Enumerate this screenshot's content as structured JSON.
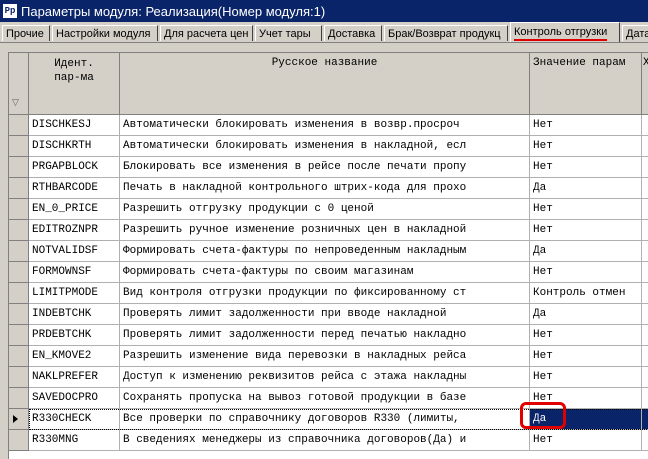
{
  "window": {
    "title": "Параметры модуля: Реализация(Номер модуля:1)",
    "icon_text": "Pp"
  },
  "tabs": [
    {
      "label": "Прочие",
      "active": false
    },
    {
      "label": "Настройки модуля",
      "active": false
    },
    {
      "label": "Для расчета цен",
      "active": false
    },
    {
      "label": "Учет тары",
      "active": false
    },
    {
      "label": "Доставка",
      "active": false
    },
    {
      "label": "Брак/Возврат продукц",
      "active": false
    },
    {
      "label": "Контроль отгрузки",
      "active": true
    },
    {
      "label": "Дата",
      "active": false
    }
  ],
  "columns": {
    "ident": "Идент.\nпар-ма",
    "name": "Русское название",
    "value": "Значение парам",
    "extra": "Х"
  },
  "rows": [
    {
      "ident": "DISCHKESJ",
      "name": "Автоматически блокировать изменения в возвр.просроч",
      "value": "Нет",
      "selected": false
    },
    {
      "ident": "DISCHKRTH",
      "name": "Автоматически блокировать изменения в накладной, есл",
      "value": "Нет",
      "selected": false
    },
    {
      "ident": "PRGAPBLOCK",
      "name": "Блокировать все изменения в рейсе после печати пропу",
      "value": "Нет",
      "selected": false
    },
    {
      "ident": "RTHBARCODE",
      "name": "Печать в накладной контрольного штрих-кода для прохо",
      "value": "Да",
      "selected": false
    },
    {
      "ident": "EN_0_PRICE",
      "name": "Разрешить отгрузку продукции с 0 ценой",
      "value": "Нет",
      "selected": false
    },
    {
      "ident": "EDITROZNPR",
      "name": "Разрешить ручное изменение розничных цен в накладной",
      "value": "Нет",
      "selected": false
    },
    {
      "ident": "NOTVALIDSF",
      "name": "Формировать счета-фактуры по непроведенным накладным",
      "value": "Да",
      "selected": false
    },
    {
      "ident": "FORMOWNSF",
      "name": "Формировать счета-фактуры по своим магазинам",
      "value": "Нет",
      "selected": false
    },
    {
      "ident": "LIMITPMODE",
      "name": "Вид контроля отгрузки продукции по фиксированному ст",
      "value": "Контроль отмен",
      "selected": false
    },
    {
      "ident": "INDEBTCHK",
      "name": "Проверять лимит задолженности при вводе накладной",
      "value": "Да",
      "selected": false
    },
    {
      "ident": "PRDEBTCHK",
      "name": "Проверять лимит задолженности перед печатью накладно",
      "value": "Нет",
      "selected": false
    },
    {
      "ident": "EN_KMOVE2",
      "name": "Разрешить изменение вида перевозки в накладных рейса",
      "value": "Нет",
      "selected": false
    },
    {
      "ident": "NAKLPREFER",
      "name": "Доступ к изменению реквизитов рейса с этажа накладны",
      "value": "Нет",
      "selected": false
    },
    {
      "ident": "SAVEDOCPRO",
      "name": "Сохранять пропуска на вывоз готовой продукции в базе",
      "value": "Нет",
      "selected": false
    },
    {
      "ident": "R330CHECK",
      "name": "Все проверки по справочнику договоров R330 (лимиты,",
      "value": "Да",
      "selected": true
    },
    {
      "ident": "R330MNG",
      "name": "В сведениях менеджеры из справочника договоров(Да) и",
      "value": "Нет",
      "selected": false
    }
  ]
}
